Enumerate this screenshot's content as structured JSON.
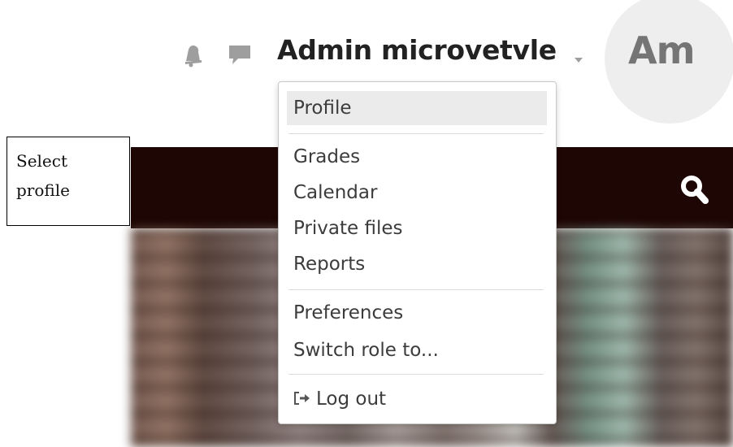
{
  "header": {
    "username": "Admin microvetvle",
    "avatar_initials": "Am",
    "icons": [
      "bell-icon",
      "chat-icon",
      "caret-down-icon",
      "search-icon"
    ]
  },
  "annotation": {
    "text": "Select profile"
  },
  "user_menu": {
    "items": [
      {
        "label": "Profile",
        "active": true
      },
      {
        "label": "Grades"
      },
      {
        "label": "Calendar"
      },
      {
        "label": "Private files"
      },
      {
        "label": "Reports"
      },
      {
        "label": "Preferences"
      },
      {
        "label": "Switch role to..."
      },
      {
        "label": "Log out",
        "icon": "logout-icon"
      }
    ]
  },
  "colors": {
    "nav_band": "#1e0604",
    "avatar_bg": "#eeeeee",
    "menu_active_bg": "#ebebeb",
    "icon_gray": "#9e9e9e"
  }
}
